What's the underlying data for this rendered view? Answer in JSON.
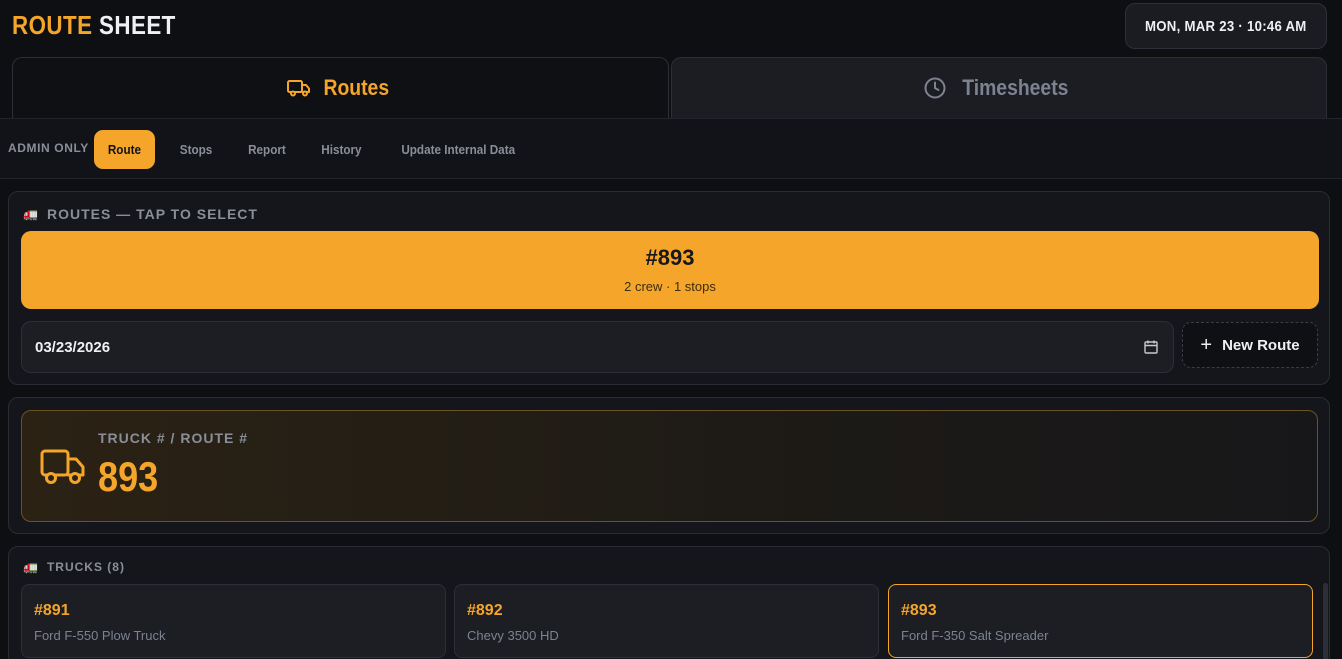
{
  "header": {
    "title_part1": "ROUTE",
    "title_part2": "SHEET",
    "datetime": "MON, MAR 23 · 10:46 AM"
  },
  "tabs": [
    {
      "label": "Routes",
      "icon": "truck-icon",
      "active": true
    },
    {
      "label": "Timesheets",
      "icon": "clock-icon",
      "active": false
    }
  ],
  "subnav": {
    "admin_label": "ADMIN ONLY",
    "items": [
      {
        "label": "Route",
        "active": true
      },
      {
        "label": "Stops",
        "active": false
      },
      {
        "label": "Report",
        "active": false
      },
      {
        "label": "History",
        "active": false
      },
      {
        "label": "Update Internal Data",
        "active": false
      }
    ]
  },
  "routes_section": {
    "label": "ROUTES — TAP TO SELECT",
    "icon": "truck-emoji",
    "selected_route": {
      "number": "#893",
      "meta": "2 crew · 1 stops"
    },
    "date_value": "03/23/2026",
    "new_route_label": "New Route"
  },
  "truck_route": {
    "label": "TRUCK # / ROUTE #",
    "value": "893"
  },
  "trucks_section": {
    "label": "TRUCKS (8)",
    "items": [
      {
        "number": "#891",
        "description": "Ford F-550 Plow Truck",
        "selected": false
      },
      {
        "number": "#892",
        "description": "Chevy 3500 HD",
        "selected": false
      },
      {
        "number": "#893",
        "description": "Ford F-350 Salt Spreader",
        "selected": true
      }
    ]
  },
  "colors": {
    "accent": "#f4a52a",
    "background": "#0e0f13",
    "card": "#15161b",
    "muted": "#8a8e99"
  }
}
